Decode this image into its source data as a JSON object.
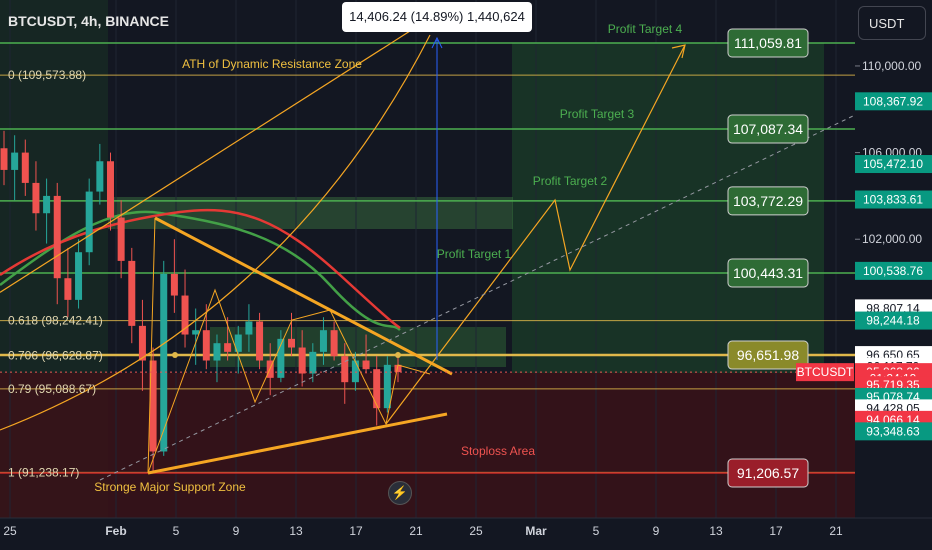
{
  "header": {
    "symbol_title": "BTCUSDT, 4h, BINANCE",
    "currency_button": "USDT"
  },
  "measure_label": "14,406.24 (14.89%) 1,440,624",
  "colors": {
    "background": "#131722",
    "green_line": "#4caf50",
    "target_box": "#2e6b35",
    "stop_box": "#9a1e2a",
    "entry_box": "#8a8a2a",
    "fib_line": "#e0b84a",
    "trend_orange": "#f5a623",
    "ma_red": "#e53935",
    "ma_green": "#43a047",
    "measure_blue": "#2962ff"
  },
  "chart_data": {
    "type": "candlestick",
    "symbol": "BTCUSDT",
    "interval": "4h",
    "exchange": "BINANCE",
    "x_tick_labels": [
      "25",
      "Feb",
      "5",
      "9",
      "13",
      "17",
      "21",
      "25",
      "Mar",
      "5",
      "9",
      "13",
      "17",
      "21"
    ],
    "y_tick_labels": [
      "110,000.00",
      "106,000.00",
      "102,000.00"
    ],
    "fib_levels": [
      {
        "label": "0 (109,573.88)",
        "value": 109573.88
      },
      {
        "label": "0.618 (98,242.41)",
        "value": 98242.41
      },
      {
        "label": "0.706 (96,628.87)",
        "value": 96628.87
      },
      {
        "label": "0.79 (95,088.67)",
        "value": 95088.67
      },
      {
        "label": "1 (91,238.17)",
        "value": 91238.17
      }
    ],
    "trade_levels": [
      {
        "name": "Profit Target 4",
        "value": 111059.81,
        "box": "111,059.81",
        "kind": "target"
      },
      {
        "name": "Profit Target 3",
        "value": 107087.34,
        "box": "107,087.34",
        "kind": "target"
      },
      {
        "name": "Profit Target 2",
        "value": 103772.29,
        "box": "103,772.29",
        "kind": "target"
      },
      {
        "name": "Profit Target 1",
        "value": 100443.31,
        "box": "100,443.31",
        "kind": "target"
      },
      {
        "name": "",
        "value": 96651.98,
        "box": "96,651.98",
        "kind": "entry"
      },
      {
        "name": "",
        "value": 91206.57,
        "box": "91,206.57",
        "kind": "stop"
      }
    ],
    "annotations": [
      "ATH of Dynamic Resistance Zone",
      "Stoploss Area",
      "Stronge Major Support Zone"
    ],
    "price_labels": [
      {
        "text": "108,367.92",
        "value": 108367.92,
        "style": "green"
      },
      {
        "text": "105,472.10",
        "value": 105472.1,
        "style": "green"
      },
      {
        "text": "103,833.61",
        "value": 103833.61,
        "style": "green"
      },
      {
        "text": "100,538.76",
        "value": 100538.76,
        "style": "green"
      },
      {
        "text": "98,807.14",
        "value": 98807.14,
        "style": "white"
      },
      {
        "text": "98,244.18",
        "value": 98244.18,
        "style": "green"
      },
      {
        "text": "96,650.65",
        "value": 96650.65,
        "style": "white"
      },
      {
        "text": "96,117.79",
        "value": 96117.79,
        "style": "white"
      },
      {
        "text": "95,863.26",
        "value": 95863.26,
        "style": "red"
      },
      {
        "text": "01:24:19",
        "value": 95560.0,
        "style": "red"
      },
      {
        "text": "95,719.35",
        "value": 95260.0,
        "style": "red"
      },
      {
        "text": "95,078.74",
        "value": 94720.0,
        "style": "green"
      },
      {
        "text": "94,428.05",
        "value": 94190.0,
        "style": "white"
      },
      {
        "text": "94,066.14",
        "value": 93660.0,
        "style": "red"
      },
      {
        "text": "93,348.63",
        "value": 93130.0,
        "style": "green"
      }
    ],
    "current_price_tag": "BTCUSDT",
    "current_price": 95863.26,
    "ylim": [
      89800,
      112400
    ],
    "ohlc_sample": [
      [
        106200,
        107000,
        104500,
        105200
      ],
      [
        105200,
        106800,
        103800,
        106000
      ],
      [
        106000,
        106600,
        104000,
        104600
      ],
      [
        104600,
        105600,
        102400,
        103200
      ],
      [
        103200,
        104800,
        101800,
        104000
      ],
      [
        104000,
        104600,
        99000,
        100200
      ],
      [
        100200,
        101600,
        98400,
        99200
      ],
      [
        99200,
        102000,
        98800,
        101400
      ],
      [
        101400,
        104800,
        100800,
        104200
      ],
      [
        104200,
        106400,
        103600,
        105600
      ],
      [
        105600,
        106000,
        102400,
        103000
      ],
      [
        103000,
        103800,
        100200,
        101000
      ],
      [
        101000,
        101600,
        97200,
        98000
      ],
      [
        98000,
        99200,
        95000,
        96400
      ],
      [
        96400,
        97000,
        91300,
        92200
      ],
      [
        92200,
        101000,
        92000,
        100400
      ],
      [
        100400,
        102000,
        98600,
        99400
      ],
      [
        99400,
        100600,
        97000,
        97600
      ],
      [
        97600,
        98800,
        96200,
        97800
      ],
      [
        97800,
        99000,
        96000,
        96400
      ],
      [
        96400,
        97600,
        95400,
        97200
      ],
      [
        97200,
        98400,
        96400,
        96800
      ],
      [
        96800,
        98000,
        95800,
        97600
      ],
      [
        97600,
        99000,
        96800,
        98200
      ],
      [
        98200,
        98600,
        96000,
        96400
      ],
      [
        96400,
        97200,
        94800,
        95600
      ],
      [
        95600,
        97800,
        95400,
        97400
      ],
      [
        97400,
        98600,
        96600,
        97000
      ],
      [
        97000,
        97800,
        95200,
        95800
      ],
      [
        95800,
        97200,
        95400,
        96800
      ],
      [
        96800,
        98400,
        96200,
        97800
      ],
      [
        97800,
        98200,
        96400,
        96600
      ],
      [
        96600,
        97200,
        94400,
        95400
      ],
      [
        95400,
        96800,
        95000,
        96400
      ],
      [
        96400,
        97600,
        95800,
        96000
      ],
      [
        96000,
        96600,
        93400,
        94200
      ],
      [
        94200,
        96600,
        94000,
        96200
      ],
      [
        96200,
        96800,
        95400,
        95863
      ]
    ]
  }
}
